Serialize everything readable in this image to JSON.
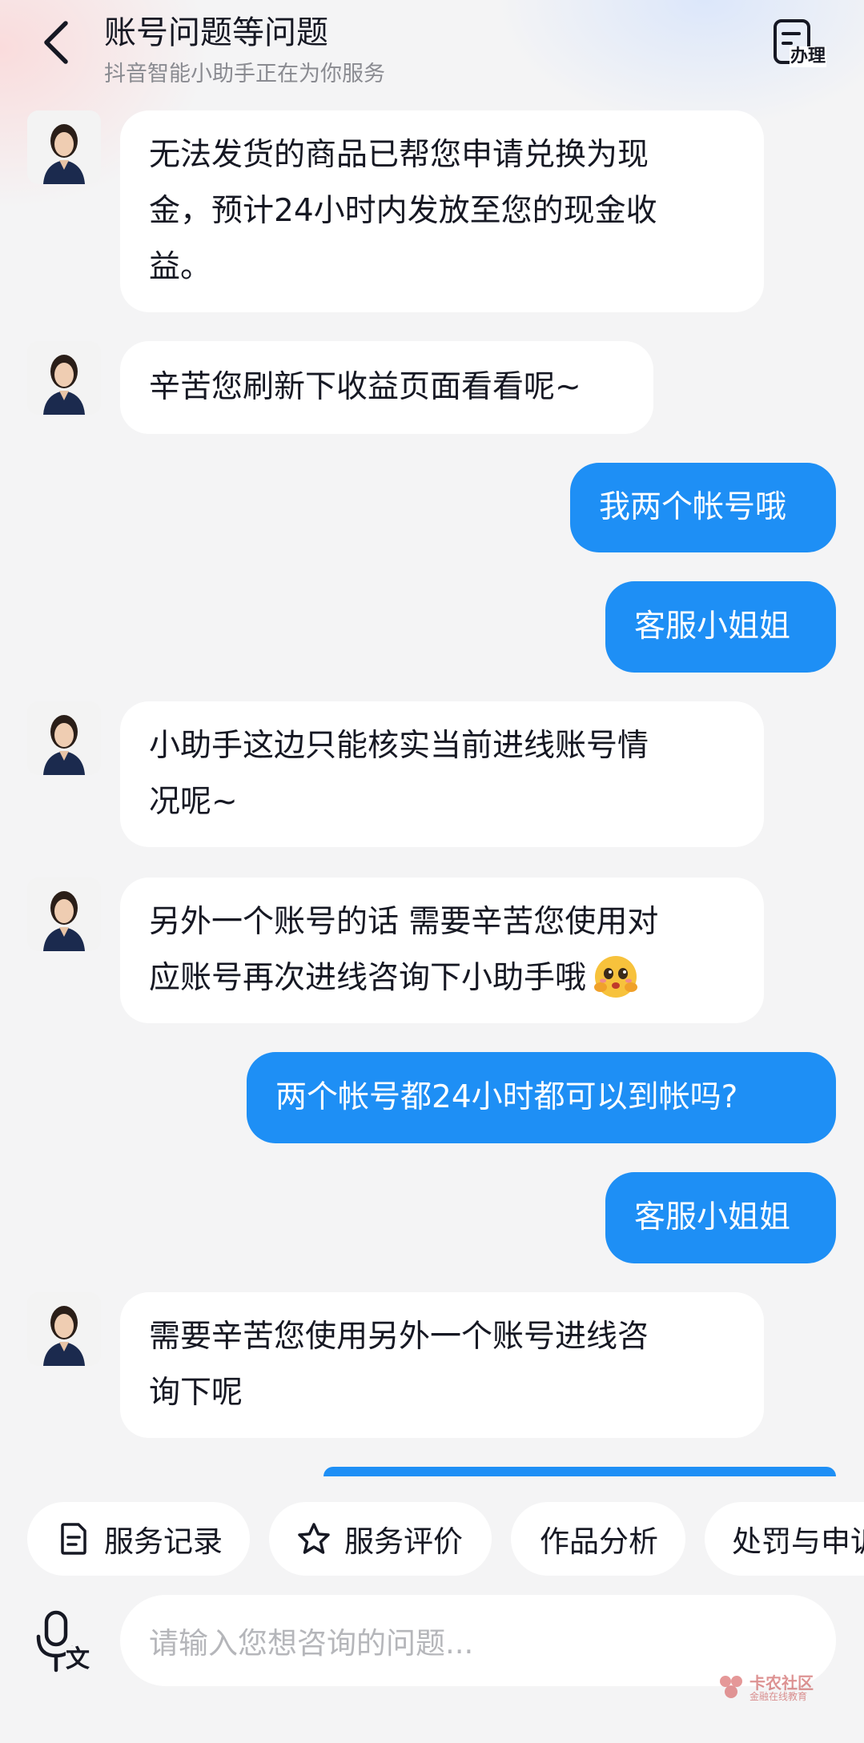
{
  "header": {
    "title": "账号问题等问题",
    "subtitle": "抖音智能小助手正在为你服务",
    "manage_label": "办理"
  },
  "messages": [
    {
      "from": "assistant",
      "lines": [
        "无法发货的商品已帮您申请兑换为现",
        "金，预计24小时内发放至您的现金收",
        "益。"
      ]
    },
    {
      "from": "assistant",
      "lines": [
        "辛苦您刷新下收益页面看看呢~"
      ]
    },
    {
      "from": "user",
      "text": "我两个帐号哦"
    },
    {
      "from": "user",
      "text": "客服小姐姐"
    },
    {
      "from": "assistant",
      "lines": [
        "小助手这边只能核实当前进线账号情",
        "况呢~"
      ]
    },
    {
      "from": "assistant",
      "lines": [
        "另外一个账号的话 需要辛苦您使用对",
        "应账号再次进线咨询下小助手哦"
      ],
      "emoji": "hugging-face"
    },
    {
      "from": "user",
      "text": "两个帐号都24小时都可以到帐吗?"
    },
    {
      "from": "user",
      "text": "客服小姐姐"
    },
    {
      "from": "assistant",
      "lines": [
        "需要辛苦您使用另外一个账号进线咨",
        "询下呢"
      ]
    }
  ],
  "quick_actions": [
    {
      "label": "服务记录",
      "icon": "document-icon"
    },
    {
      "label": "服务评价",
      "icon": "star-icon"
    },
    {
      "label": "作品分析"
    },
    {
      "label": "处罚与申诉"
    }
  ],
  "input": {
    "placeholder": "请输入您想咨询的问题..."
  },
  "voice_button_label": "文",
  "watermark": {
    "title": "卡农社区",
    "subtitle": "金融在线教育"
  },
  "colors": {
    "user_bubble": "#1e8ff5",
    "bot_bubble": "#ffffff",
    "background": "#f4f4f5"
  }
}
